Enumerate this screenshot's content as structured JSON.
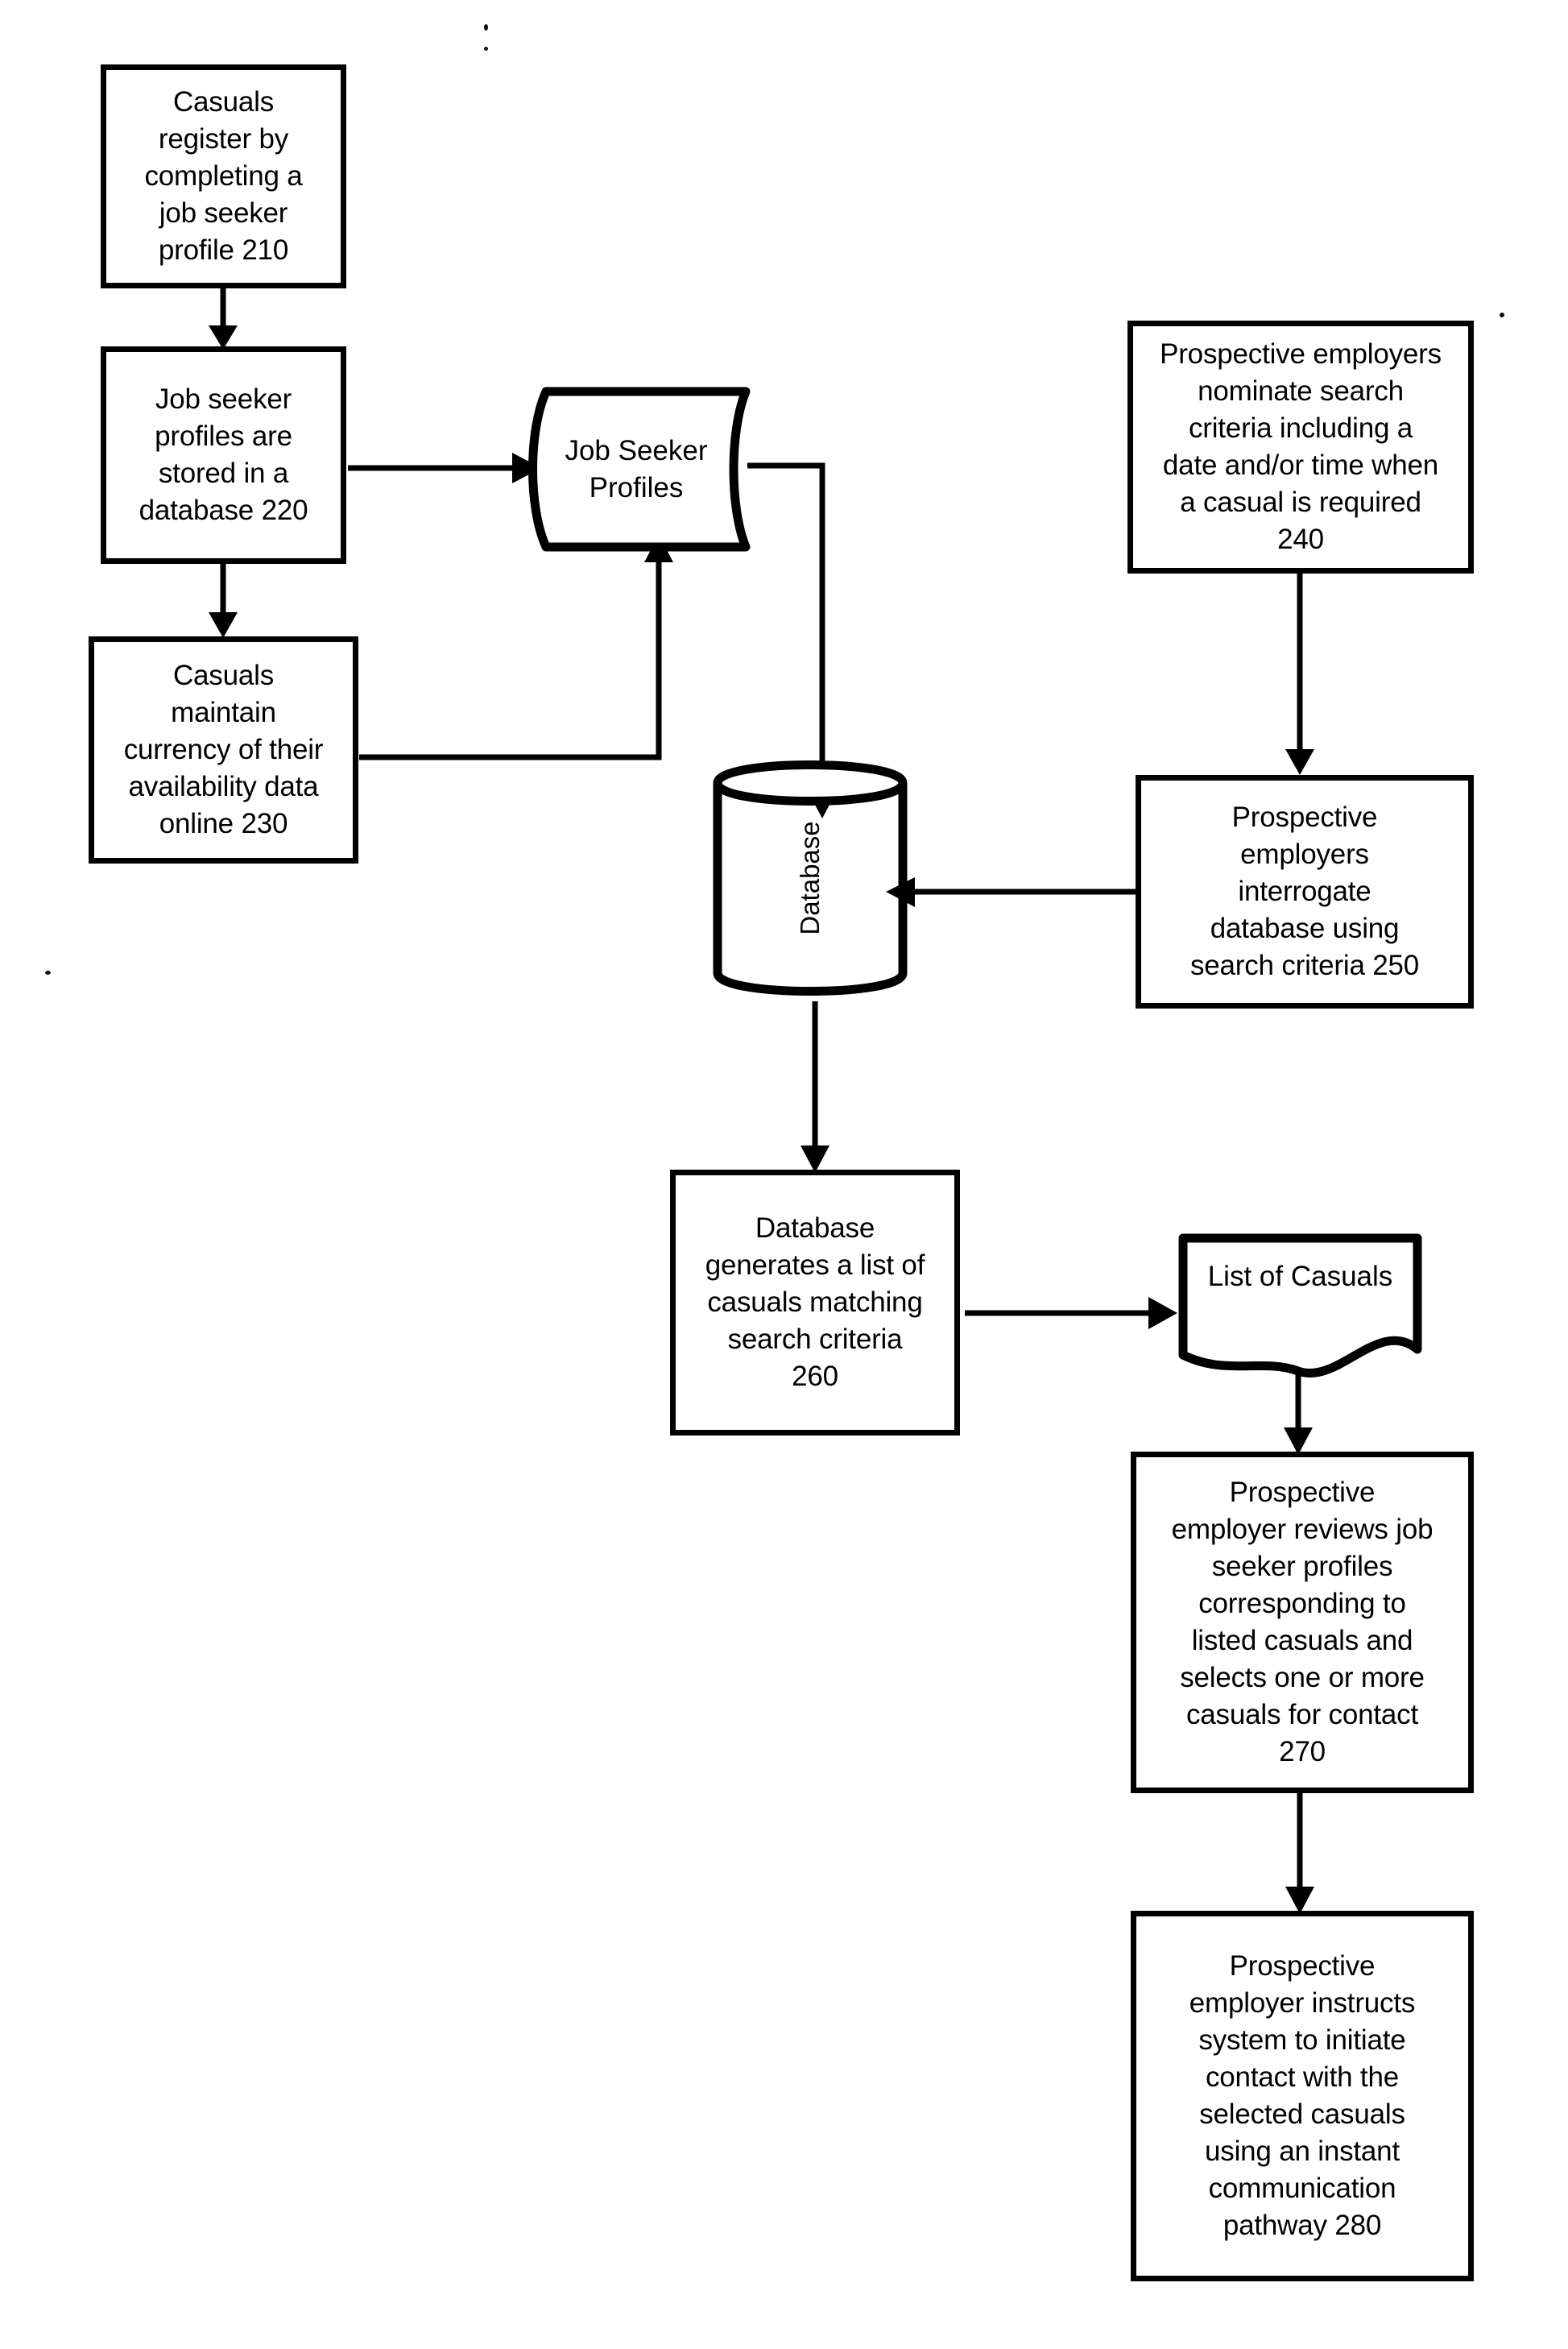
{
  "diagram": {
    "title": "Casual job seeker matching system flowchart",
    "stroke_color": "#000000",
    "background_color": "#ffffff",
    "nodes": [
      {
        "id": "210",
        "shape": "process",
        "label": "Casuals\nregister by\ncompleting a\njob seeker\nprofile 210"
      },
      {
        "id": "220",
        "shape": "process",
        "label": "Job seeker\nprofiles are\nstored in a\ndatabase 220"
      },
      {
        "id": "230",
        "shape": "process",
        "label": "Casuals\nmaintain\ncurrency of their\navailability data\nonline 230"
      },
      {
        "id": "job-seeker-profiles",
        "shape": "stored-data",
        "label": "Job Seeker\nProfiles"
      },
      {
        "id": "240",
        "shape": "process",
        "label": "Prospective employers\nnominate search\ncriteria including a\ndate and/or time when\na casual is required\n240"
      },
      {
        "id": "250",
        "shape": "process",
        "label": "Prospective\nemployers\ninterrogate\ndatabase using\nsearch criteria 250"
      },
      {
        "id": "database",
        "shape": "cylinder",
        "label": "Database"
      },
      {
        "id": "260",
        "shape": "process",
        "label": "Database\ngenerates a list of\ncasuals matching\nsearch criteria\n260"
      },
      {
        "id": "list-of-casuals",
        "shape": "document",
        "label": "List of Casuals"
      },
      {
        "id": "270",
        "shape": "process",
        "label": "Prospective\nemployer reviews job\nseeker profiles\ncorresponding to\nlisted casuals and\nselects one or more\ncasuals for contact\n270"
      },
      {
        "id": "280",
        "shape": "process",
        "label": "Prospective\nemployer instructs\nsystem to initiate\ncontact with the\nselected casuals\nusing an instant\ncommunication\npathway 280"
      }
    ],
    "edges": [
      {
        "from": "210",
        "to": "220",
        "direction": "down"
      },
      {
        "from": "220",
        "to": "230",
        "direction": "down"
      },
      {
        "from": "220",
        "to": "job-seeker-profiles",
        "direction": "right"
      },
      {
        "from": "230",
        "to": "job-seeker-profiles",
        "direction": "right-then-up"
      },
      {
        "from": "job-seeker-profiles",
        "to": "database",
        "direction": "right-then-down"
      },
      {
        "from": "240",
        "to": "250",
        "direction": "down"
      },
      {
        "from": "250",
        "to": "database",
        "direction": "left"
      },
      {
        "from": "database",
        "to": "260",
        "direction": "down"
      },
      {
        "from": "260",
        "to": "list-of-casuals",
        "direction": "right"
      },
      {
        "from": "list-of-casuals",
        "to": "270",
        "direction": "down"
      },
      {
        "from": "270",
        "to": "280",
        "direction": "down"
      }
    ]
  }
}
